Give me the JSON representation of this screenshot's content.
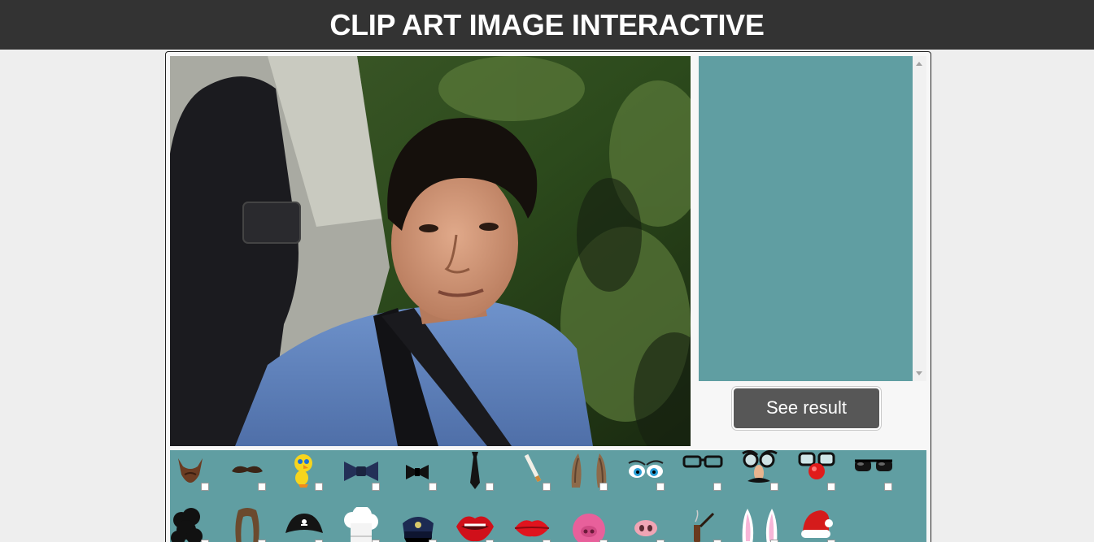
{
  "header": {
    "title": "CLIP ART IMAGE INTERACTIVE"
  },
  "result": {
    "button_label": "See result"
  },
  "clipart": {
    "row1": [
      "beard",
      "mustache",
      "tweety-bird",
      "bow-tie-blue",
      "bow-tie-black",
      "necktie",
      "cigarette",
      "deer-ears",
      "cartoon-eyes",
      "glasses",
      "groucho-glasses",
      "clown-nose-glasses",
      "sunglasses"
    ],
    "row2": [
      "curly-hair",
      "long-hair",
      "pirate-hat",
      "chef-hat",
      "police-cap",
      "lips-open",
      "lips-red",
      "pig-face",
      "pig-nose",
      "pipe",
      "bunny-ears",
      "santa-hat"
    ]
  },
  "colors": {
    "header_bg": "#333333",
    "teal": "#609ea2",
    "button_bg": "#575757",
    "page_bg": "#eeeeee"
  }
}
